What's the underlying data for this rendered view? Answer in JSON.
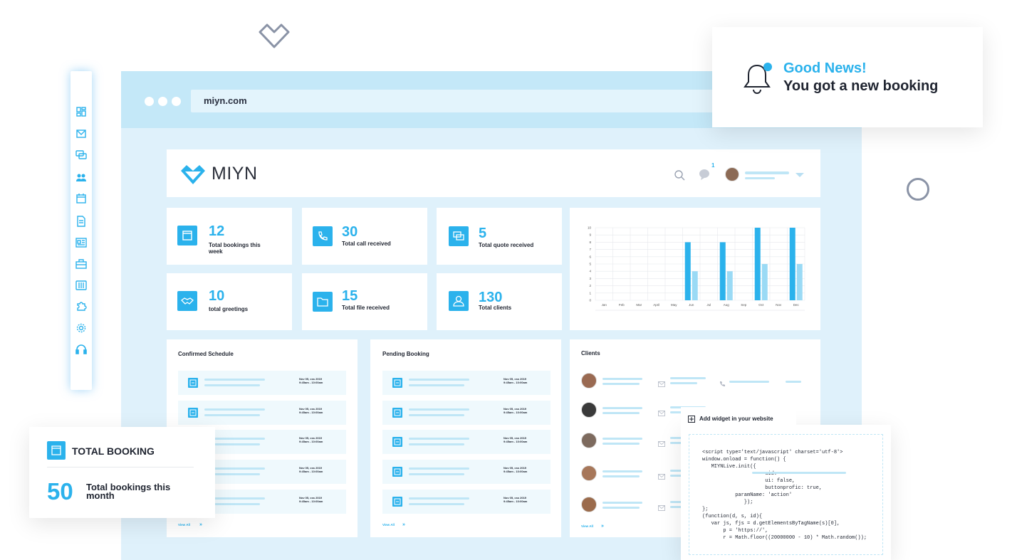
{
  "browser": {
    "url": "miyn.com"
  },
  "brand": {
    "name": "MIYN"
  },
  "header": {
    "notification_count": "1"
  },
  "sidebar": {
    "items": [
      "dashboard-icon",
      "mail-icon",
      "chat-icon",
      "users-icon",
      "calendar-icon",
      "document-icon",
      "newspaper-icon",
      "briefcase-icon",
      "sliders-icon",
      "puzzle-icon",
      "gear-icon",
      "headset-icon"
    ]
  },
  "stats": [
    {
      "value": "12",
      "label": "Total bookings this week",
      "icon": "calendar-icon"
    },
    {
      "value": "30",
      "label": "Total call received",
      "icon": "phone-icon"
    },
    {
      "value": "5",
      "label": "Total quote received",
      "icon": "chat-icon"
    },
    {
      "value": "10",
      "label": "total greetings",
      "icon": "handshake-icon"
    },
    {
      "value": "15",
      "label": "Total file received",
      "icon": "folder-icon"
    },
    {
      "value": "130",
      "label": "Total clients",
      "icon": "user-icon"
    }
  ],
  "chart_data": {
    "type": "bar",
    "categories": [
      "Jan",
      "Feb",
      "Mar",
      "April",
      "May",
      "Jun",
      "Jul",
      "Aug",
      "Sep",
      "Oct",
      "Nov",
      "Dec"
    ],
    "series": [
      {
        "values": [
          0,
          0,
          0,
          0,
          0,
          8,
          0,
          8,
          0,
          10,
          0,
          10
        ]
      },
      {
        "values": [
          0,
          0,
          0,
          0,
          0,
          4,
          0,
          4,
          0,
          5,
          0,
          5
        ]
      }
    ],
    "yticks": [
      "0",
      "1",
      "2",
      "3",
      "4",
      "5",
      "6",
      "7",
      "8",
      "9",
      "10"
    ],
    "ylim": [
      0,
      10
    ],
    "grid": true,
    "colors": [
      "#2bb2ec",
      "#9adaf5"
    ]
  },
  "panels": {
    "confirmed": {
      "title": "Confirmed Schedule",
      "view_all": "View All",
      "arrow": "»",
      "dates": [
        [
          "Nov 05, css 2019",
          "9:45am - 10:00am"
        ],
        [
          "Nov 05, css 2019",
          "9:45am - 10:00am"
        ],
        [
          "Nov 05, css 2019",
          "9:45am - 10:00am"
        ],
        [
          "Nov 05, css 2019",
          "9:45am - 10:00am"
        ],
        [
          "Nov 05, css 2019",
          "9:45am - 10:00am"
        ]
      ]
    },
    "pending": {
      "title": "Pending Booking",
      "view_all": "View All",
      "arrow": "»",
      "dates": [
        [
          "Nov 05, css 2019",
          "9:45am - 10:00am"
        ],
        [
          "Nov 05, css 2019",
          "9:45am - 10:00am"
        ],
        [
          "Nov 05, css 2019",
          "9:45am - 10:00am"
        ],
        [
          "Nov 05, css 2019",
          "9:45am - 10:00am"
        ],
        [
          "Nov 05, css 2019",
          "9:45am - 10:00am"
        ]
      ]
    },
    "clients": {
      "title": "Clients",
      "view_all": "View All",
      "arrow": "»"
    }
  },
  "notification": {
    "title": "Good News!",
    "message": "You got a new booking"
  },
  "total_booking": {
    "title": "TOTAL BOOKING",
    "value": "50",
    "label": "Total bookings this month"
  },
  "widget": {
    "title": "Add widget in your website",
    "code": [
      "<script type='text/javascript' charset='utf-8'>",
      "window.onload = function() {",
      "   MIYNLive.init({",
      "                     uid:",
      "                     ui: false,",
      "                     buttonprofic: true,",
      "           paramName: 'action'",
      "              });",
      "};",
      "(function(d, s, id){",
      "   var js, fjs = d.getElementsByTagName(s)[0],",
      "       p = 'https://',",
      "       r = Math.floor((20000000 - 10) * Math.random());"
    ]
  }
}
